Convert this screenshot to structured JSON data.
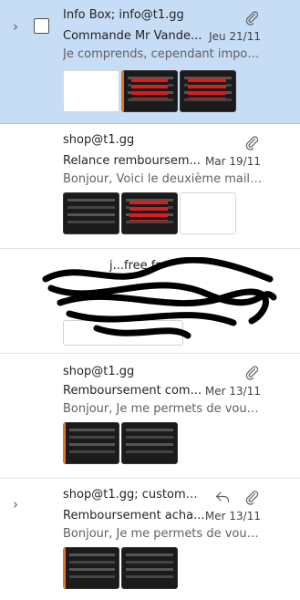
{
  "messages": [
    {
      "sender": "Info Box; info@t1.gg",
      "subject": "Commande Mr Vande...",
      "date": "Jeu 21/11",
      "preview": "Je comprends, cependant imposs...",
      "selected": true,
      "has_attachment": true,
      "replied": false
    },
    {
      "sender": "shop@t1.gg",
      "subject": "Relance remboursem...",
      "date": "Mar 19/11",
      "preview": "Bonjour, Voici le deuxième mail q...",
      "selected": false,
      "has_attachment": true,
      "replied": false
    },
    {
      "sender": "j...free.fr",
      "selected": false,
      "redacted": true
    },
    {
      "sender": "shop@t1.gg",
      "subject": "Remboursement com...",
      "date": "Mer 13/11",
      "preview": "Bonjour, Je me permets de vous ...",
      "selected": false,
      "has_attachment": true,
      "replied": false
    },
    {
      "sender": "shop@t1.gg; customer...",
      "subject": "Remboursement acha...",
      "date": "Mer 13/11",
      "preview": "Bonjour, Je me permets de vous ...",
      "selected": false,
      "has_attachment": true,
      "replied": true
    }
  ],
  "icons": {
    "expand": "chevron-right-icon",
    "attachment": "paperclip-icon",
    "reply": "reply-arrow-icon"
  },
  "colors": {
    "selected_bg": "#c7dcf5",
    "redaction": "#000000"
  }
}
